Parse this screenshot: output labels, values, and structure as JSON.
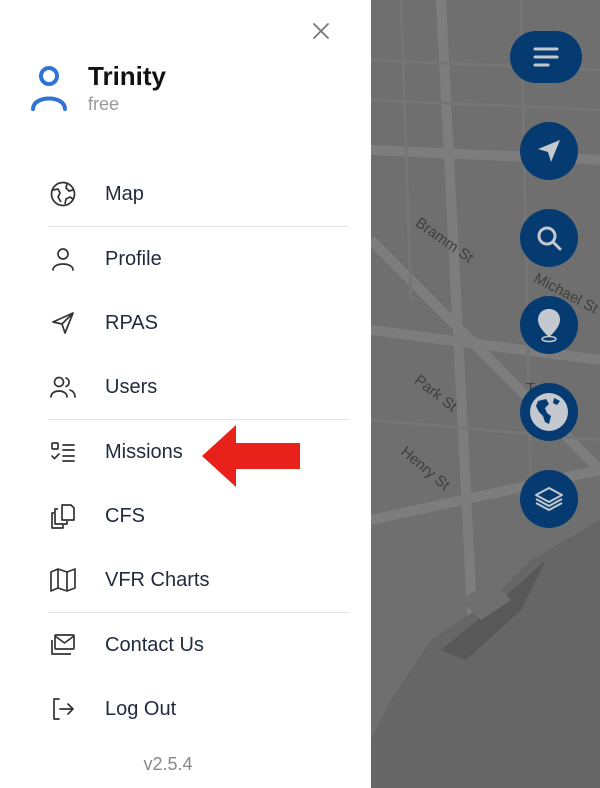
{
  "user": {
    "name": "Trinity",
    "plan": "free"
  },
  "menu": {
    "items": [
      {
        "id": "map",
        "label": "Map",
        "icon": "globe-icon"
      },
      {
        "id": "profile",
        "label": "Profile",
        "icon": "user-icon"
      },
      {
        "id": "rpas",
        "label": "RPAS",
        "icon": "paper-plane-icon"
      },
      {
        "id": "users",
        "label": "Users",
        "icon": "users-icon"
      },
      {
        "id": "missions",
        "label": "Missions",
        "icon": "checklist-icon"
      },
      {
        "id": "cfs",
        "label": "CFS",
        "icon": "documents-icon"
      },
      {
        "id": "vfr-charts",
        "label": "VFR Charts",
        "icon": "folded-map-icon"
      },
      {
        "id": "contact-us",
        "label": "Contact Us",
        "icon": "mail-icon"
      },
      {
        "id": "log-out",
        "label": "Log Out",
        "icon": "logout-icon"
      }
    ]
  },
  "version": "v2.5.4",
  "map": {
    "streets": [
      "Bramm St",
      "Michael St",
      "Park St",
      "Henry St",
      "T"
    ]
  },
  "colors": {
    "accent": "#2f73d6",
    "fab": "#063b71",
    "arrow": "#e8211b",
    "map": "#6f6f6f"
  }
}
